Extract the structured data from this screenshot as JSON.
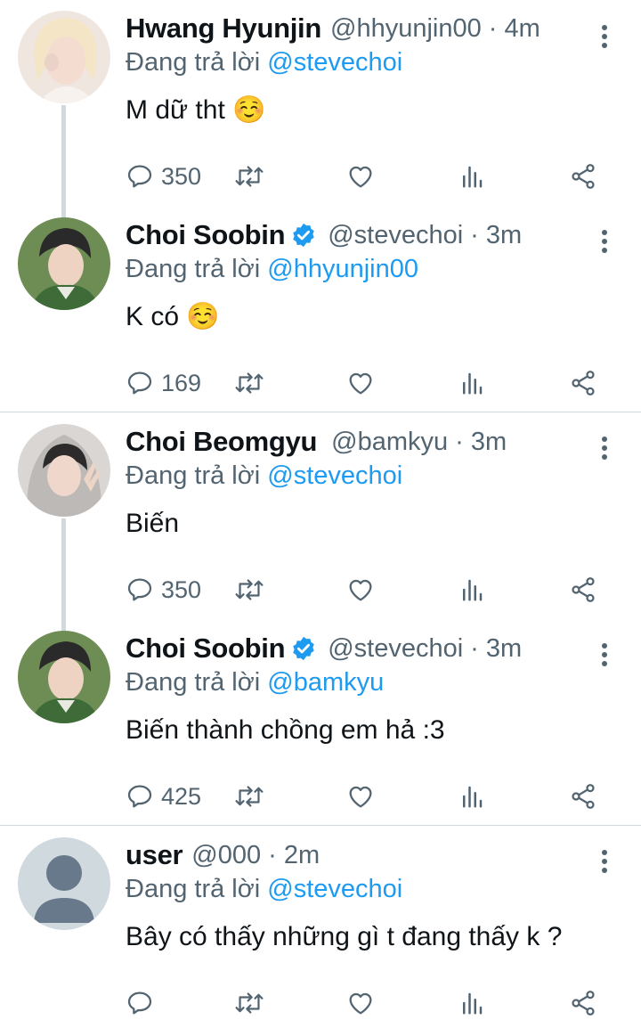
{
  "tweets": [
    {
      "name": "Hwang Hyunjin",
      "handle": "@hhyunjin00",
      "time": "· 4m",
      "reply_prefix": "Đang trả lời",
      "reply_to": "@stevechoi",
      "text": "M dữ tht ☺️",
      "replies": "350",
      "verified": false
    },
    {
      "name": "Choi Soobin",
      "handle": "@stevechoi",
      "time": "· 3m",
      "reply_prefix": "Đang trả lời",
      "reply_to": "@hhyunjin00",
      "text": "K có ☺️",
      "replies": "169",
      "verified": true
    },
    {
      "name": "Choi Beomgyu",
      "handle": "@bamkyu",
      "time": "· 3m",
      "reply_prefix": "Đang trả lời",
      "reply_to": "@stevechoi",
      "text": "Biến",
      "replies": "350",
      "verified": false
    },
    {
      "name": "Choi Soobin",
      "handle": "@stevechoi",
      "time": "· 3m",
      "reply_prefix": "Đang trả lời",
      "reply_to": "@bamkyu",
      "text": "Biến thành chồng em hả :3",
      "replies": "425",
      "verified": true
    },
    {
      "name": "user",
      "handle": "@000",
      "time": "· 2m",
      "reply_prefix": "Đang trả lời",
      "reply_to": "@stevechoi",
      "text": "Bây có thấy những gì t đang thấy k ?",
      "replies": "",
      "verified": false
    }
  ],
  "icons": {
    "reply": "reply-icon",
    "retweet": "retweet-icon",
    "like": "heart-icon",
    "views": "analytics-icon",
    "share": "share-icon",
    "more": "more-vertical-icon",
    "verified": "verified-badge-icon"
  },
  "colors": {
    "text": "#0f1419",
    "muted": "#536471",
    "link": "#1d9bf0",
    "line": "#cfd9de"
  }
}
